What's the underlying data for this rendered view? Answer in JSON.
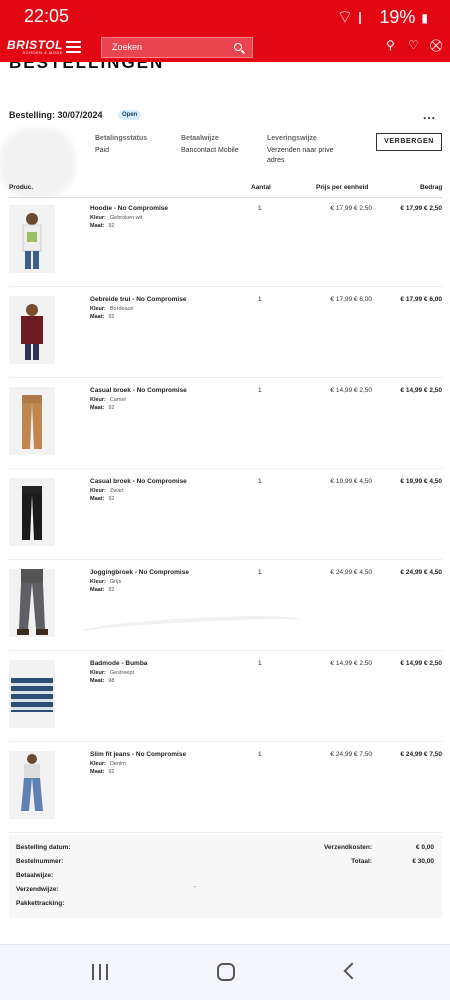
{
  "status_bar": {
    "time": "22:05",
    "battery": "19%"
  },
  "header": {
    "logo": "BRISTOL",
    "logo_sub": "SCHOEN & MODE",
    "search_placeholder": "Zoeken"
  },
  "page": {
    "title": "BESTELLINGEN"
  },
  "order": {
    "heading": "Bestelling: 30/07/2024",
    "status_badge": "Open",
    "more_label": "...",
    "payment_status_label": "Betalingsstatus",
    "payment_status": "Paid",
    "payment_method_label": "Betaalwijze",
    "payment_method": "Bancontact Mobile",
    "delivery_label": "Leveringswijze",
    "delivery_line1": "Verzenden naar prive",
    "delivery_line2": "adres",
    "hide_button": "VERBERGEN"
  },
  "table": {
    "columns": {
      "product": "Produc.",
      "qty": "Aantal",
      "unit": "Prijs per eenheid",
      "amount": "Bedrag"
    },
    "color_label": "Kleur:",
    "size_label": "Maat:",
    "rows": [
      {
        "name": "Hoodie - No Compromise",
        "color": "Gebroken wit",
        "size": "92",
        "qty": "1",
        "unit": "€ 17,99 € 2,50",
        "amount": "€ 17,99 € 2,50"
      },
      {
        "name": "Gebreide trui - No Compromise",
        "color": "Bordeaux",
        "size": "92",
        "qty": "1",
        "unit": "€ 17,99 € 6,00",
        "amount": "€ 17,99 € 6,00"
      },
      {
        "name": "Casual broek - No Compromise",
        "color": "Camel",
        "size": "92",
        "qty": "1",
        "unit": "€ 14,99 € 2,50",
        "amount": "€ 14,99 € 2,50"
      },
      {
        "name": "Casual broek - No Compromise",
        "color": "Zwart",
        "size": "92",
        "qty": "1",
        "unit": "€ 19,99 € 4,50",
        "amount": "€ 19,99 € 4,50"
      },
      {
        "name": "Joggingbroek - No Compromise",
        "color": "Grijs",
        "size": "92",
        "qty": "1",
        "unit": "€ 24,99 € 4,50",
        "amount": "€ 24,99 € 4,50"
      },
      {
        "name": "Badmode - Bumba",
        "color": "Gestreept",
        "size": "98",
        "qty": "1",
        "unit": "€ 14,99 € 2,50",
        "amount": "€ 14,99 € 2,50"
      },
      {
        "name": "Slim fit jeans - No Compromise",
        "color": "Denim",
        "size": "92",
        "qty": "1",
        "unit": "€ 24,99 € 7,50",
        "amount": "€ 24,99 € 7,50"
      }
    ]
  },
  "summary": {
    "order_date": "Bestelling datum:",
    "order_number": "Bestelnummer:",
    "payment_method": "Betaalwijze:",
    "shipping_method": "Verzendwijze:",
    "tracking": "Pakkettracking:",
    "shipping_cost_label": "Verzendkosten:",
    "shipping_cost": "€ 0,00",
    "total_label": "Totaal:",
    "total": "€ 30,00",
    "shipping_dot": "-"
  }
}
